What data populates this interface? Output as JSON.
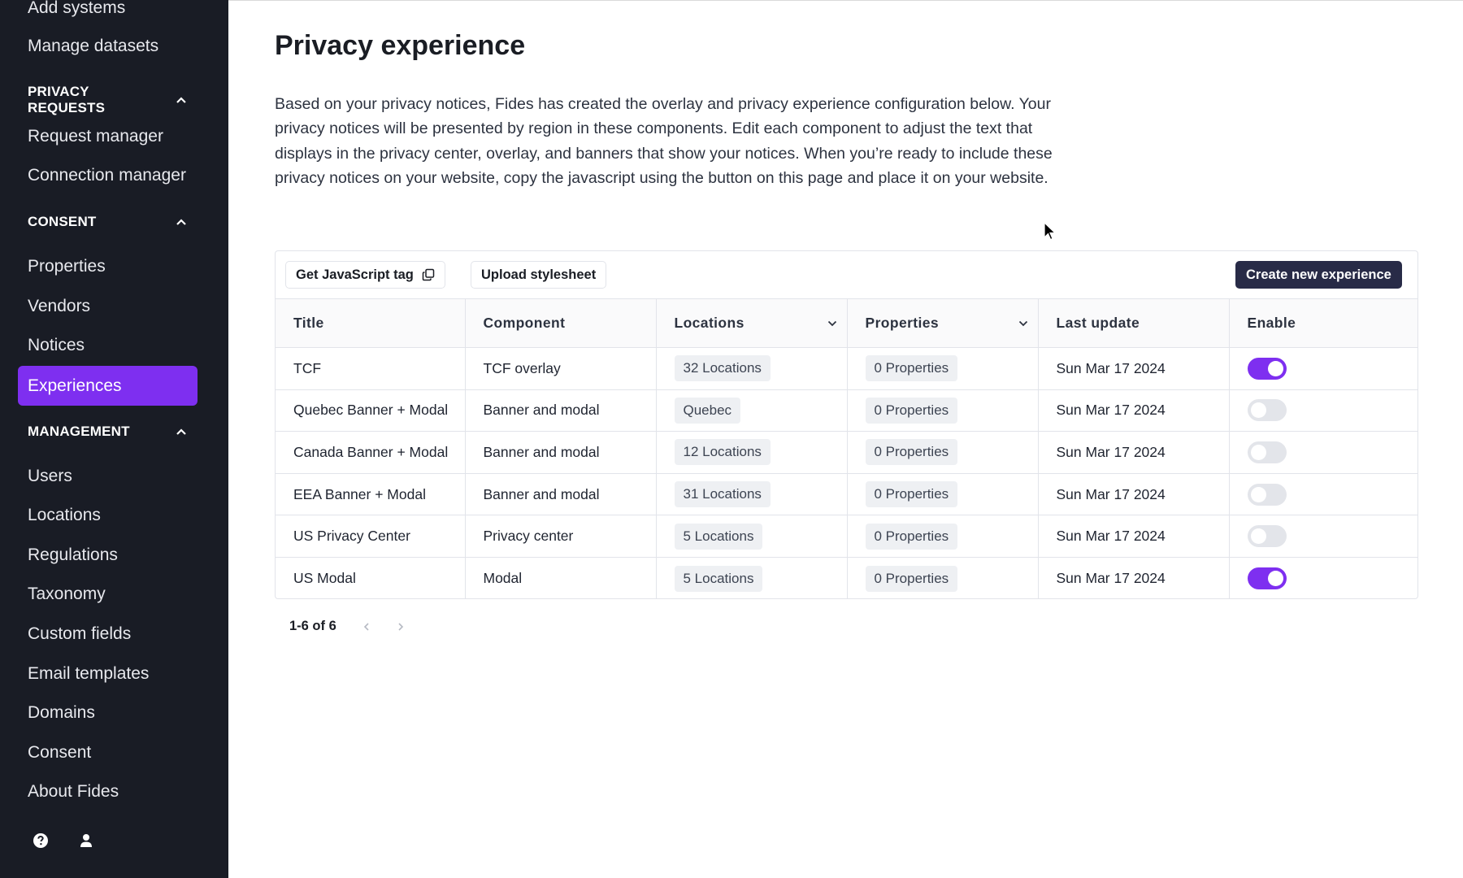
{
  "sidebar": {
    "items_top": [
      {
        "label": "Add systems"
      },
      {
        "label": "Manage datasets"
      }
    ],
    "section_privacy": {
      "label": "PRIVACY REQUESTS"
    },
    "items_privacy": [
      {
        "label": "Request manager"
      },
      {
        "label": "Connection manager"
      }
    ],
    "section_consent": {
      "label": "CONSENT"
    },
    "items_consent": [
      {
        "label": "Properties"
      },
      {
        "label": "Vendors"
      },
      {
        "label": "Notices"
      },
      {
        "label": "Experiences",
        "active": true
      }
    ],
    "section_management": {
      "label": "MANAGEMENT"
    },
    "items_management": [
      {
        "label": "Users"
      },
      {
        "label": "Locations"
      },
      {
        "label": "Regulations"
      },
      {
        "label": "Taxonomy"
      },
      {
        "label": "Custom fields"
      },
      {
        "label": "Email templates"
      },
      {
        "label": "Domains"
      },
      {
        "label": "Consent"
      },
      {
        "label": "About Fides"
      }
    ],
    "bottom_icons": [
      "help-icon",
      "user-icon"
    ],
    "colors": {
      "background": "#191c25",
      "active": "#7e2ff0"
    }
  },
  "main": {
    "title": "Privacy experience",
    "description": "Based on your privacy notices, Fides has created the overlay and privacy experience configuration below. Your privacy notices will be presented by region in these components. Edit each component to adjust the text that displays in the privacy center, overlay, and banners that show your notices. When you’re ready to include these privacy notices on your website, copy the javascript using the button on this page and place it on your website.",
    "toolbar": {
      "get_js_label": "Get JavaScript tag",
      "upload_label": "Upload stylesheet",
      "create_label": "Create new experience"
    },
    "table": {
      "columns": [
        "Title",
        "Component",
        "Locations",
        "Properties",
        "Last update",
        "Enable"
      ],
      "rows": [
        {
          "title": "TCF",
          "component": "TCF overlay",
          "locations": "32 Locations",
          "properties": "0 Properties",
          "updated": "Sun Mar 17 2024",
          "enabled": true
        },
        {
          "title": "Quebec Banner + Modal",
          "component": "Banner and modal",
          "locations": "Quebec",
          "properties": "0 Properties",
          "updated": "Sun Mar 17 2024",
          "enabled": false
        },
        {
          "title": "Canada Banner + Modal",
          "component": "Banner and modal",
          "locations": "12 Locations",
          "properties": "0 Properties",
          "updated": "Sun Mar 17 2024",
          "enabled": false
        },
        {
          "title": "EEA Banner + Modal",
          "component": "Banner and modal",
          "locations": "31 Locations",
          "properties": "0 Properties",
          "updated": "Sun Mar 17 2024",
          "enabled": false
        },
        {
          "title": "US Privacy Center",
          "component": "Privacy center",
          "locations": "5 Locations",
          "properties": "0 Properties",
          "updated": "Sun Mar 17 2024",
          "enabled": false
        },
        {
          "title": "US Modal",
          "component": "Modal",
          "locations": "5 Locations",
          "properties": "0 Properties",
          "updated": "Sun Mar 17 2024",
          "enabled": true
        }
      ]
    },
    "pagination": {
      "label": "1-6 of 6"
    },
    "colors": {
      "accent": "#7e2ff0",
      "primary_button": "#282b47"
    }
  }
}
